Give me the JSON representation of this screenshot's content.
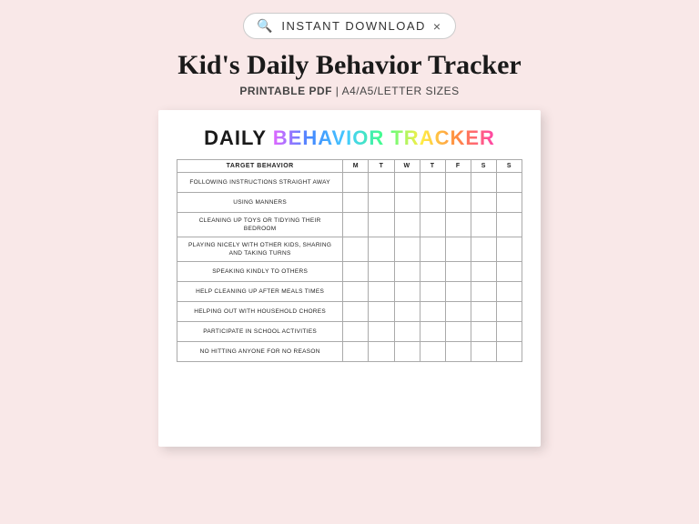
{
  "search_bar": {
    "label": "INSTANT DOWNLOAD",
    "close": "×"
  },
  "header": {
    "title": "Kid's Daily Behavior Tracker",
    "subtitle_bold": "PRINTABLE PDF",
    "subtitle_rest": " | A4/A5/LETTER SIZES"
  },
  "tracker": {
    "title_daily": "DAILY ",
    "title_colored": "BEHAVIOR TRACKER",
    "col_header_behavior": "TARGET BEHAVIOR",
    "days": [
      "M",
      "T",
      "W",
      "T",
      "F",
      "S",
      "S"
    ],
    "rows": [
      "FOLLOWING INSTRUCTIONS STRAIGHT AWAY",
      "USING MANNERS",
      "CLEANING UP TOYS OR TIDYING THEIR BEDROOM",
      "PLAYING NICELY WITH OTHER KIDS, SHARING AND TAKING TURNS",
      "SPEAKING KINDLY TO OTHERS",
      "HELP CLEANING UP AFTER MEALS TIMES",
      "HELPING OUT WITH HOUSEHOLD CHORES",
      "PARTICIPATE IN SCHOOL ACTIVITIES",
      "NO HITTING ANYONE FOR NO REASON"
    ]
  }
}
